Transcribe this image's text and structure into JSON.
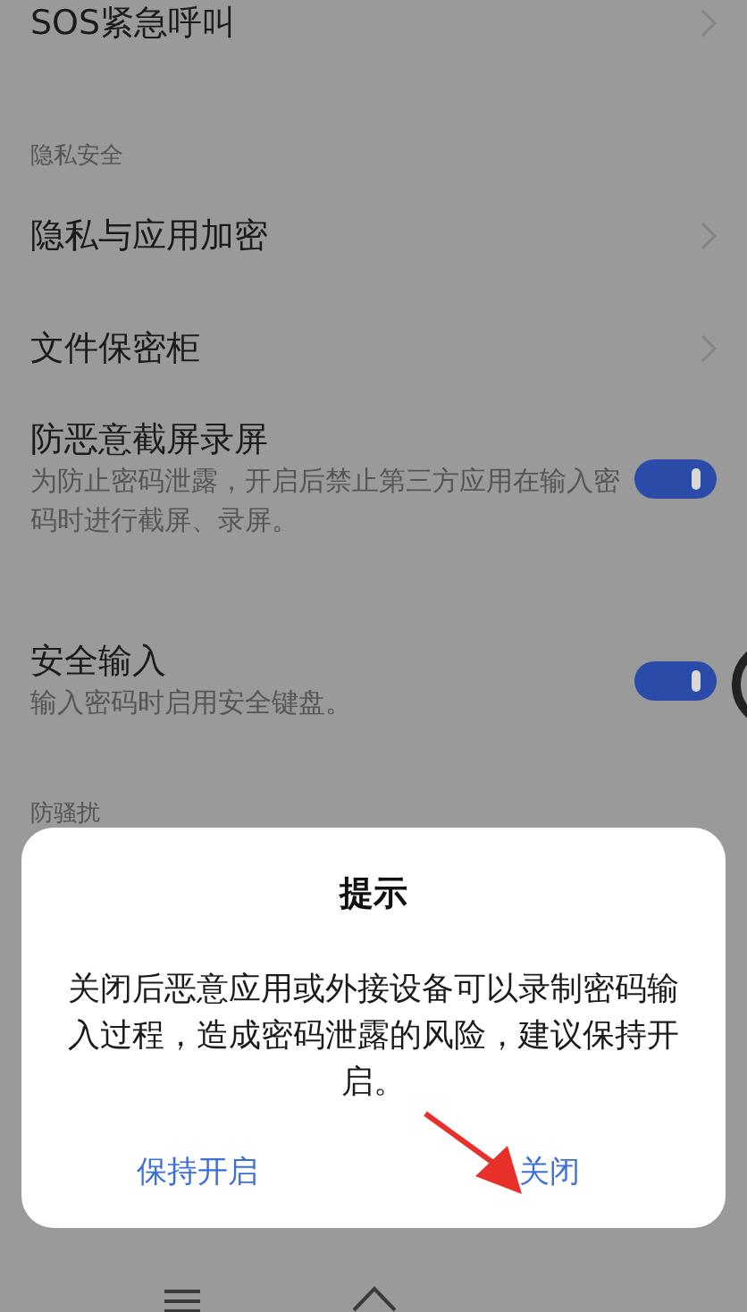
{
  "settings": [
    {
      "kind": "link",
      "title": "SOS紧急呼叫"
    },
    {
      "kind": "header",
      "title": "隐私安全"
    },
    {
      "kind": "link",
      "title": "隐私与应用加密"
    },
    {
      "kind": "link",
      "title": "文件保密柜"
    },
    {
      "kind": "toggle",
      "title": "防恶意截屏录屏",
      "description": "为防止密码泄露，开启后禁止第三方应用在输入密码时进行截屏、录屏。",
      "on": true
    },
    {
      "kind": "toggle",
      "title": "安全输入",
      "description": "输入密码时启用安全键盘。",
      "on": true
    },
    {
      "kind": "header",
      "title": "防骚扰"
    }
  ],
  "dialog": {
    "title": "提示",
    "message": "关闭后恶意应用或外接设备可以录制密码输入过程，造成密码泄露的风险，建议保持开启。",
    "buttons": [
      {
        "label": "保持开启"
      },
      {
        "label": "关闭"
      }
    ]
  }
}
